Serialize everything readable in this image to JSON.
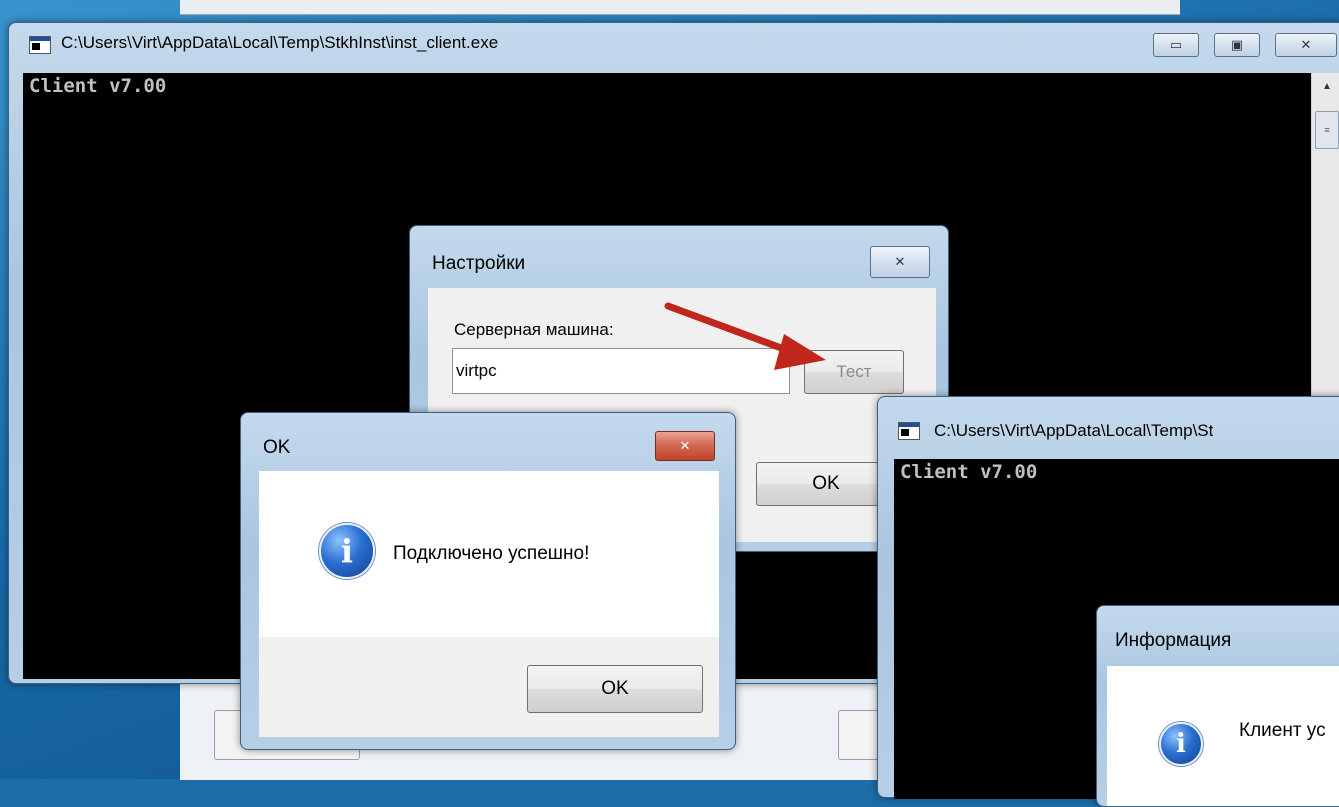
{
  "console_window": {
    "title": "C:\\Users\\Virt\\AppData\\Local\\Temp\\StkhInst\\inst_client.exe",
    "output": "Client v7.00",
    "minimize_glyph": "▭",
    "maximize_glyph": "▣",
    "close_glyph": "✕"
  },
  "settings_dialog": {
    "title": "Настройки",
    "close_glyph": "✕",
    "server_label": "Серверная машина:",
    "server_value": "virtpc",
    "test_button": "Тест",
    "ok_button": "OK"
  },
  "ok_dialog": {
    "title": "OK",
    "close_glyph": "✕",
    "message": "Подключено успешно!",
    "ok_button": "OK",
    "icon": "info-icon"
  },
  "console_window_2": {
    "title": "C:\\Users\\Virt\\AppData\\Local\\Temp\\St",
    "output": "Client v7.00"
  },
  "info_dialog": {
    "title": "Информация",
    "message": "Клиент ус",
    "icon": "info-icon"
  },
  "colors": {
    "annotation_arrow": "#c0261b",
    "console_bg": "#000000",
    "dialog_bg": "#f0f0f0"
  }
}
